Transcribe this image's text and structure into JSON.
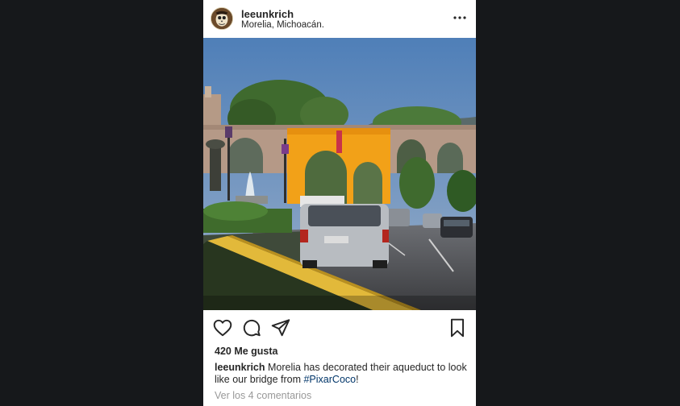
{
  "post": {
    "username": "leeunkrich",
    "location": "Morelia, Michoacán.",
    "more_icon": "more-options-icon",
    "image_alt": "Morelia aqueduct decorated with orange marigolds",
    "actions": {
      "like_icon": "heart-icon",
      "comment_icon": "comment-icon",
      "share_icon": "send-icon",
      "save_icon": "bookmark-icon"
    },
    "likes": "420 Me gusta",
    "caption": {
      "username": "leeunkrich",
      "text": "Morelia has decorated their aqueduct to look like our bridge from",
      "hashtag": "#PixarCoco",
      "suffix": "!"
    },
    "view_comments": "Ver los 4 comentarios",
    "colors": {
      "background": "#16181b",
      "hashtag": "#003569",
      "muted": "#999999",
      "arch_orange": "#f2a118"
    }
  }
}
